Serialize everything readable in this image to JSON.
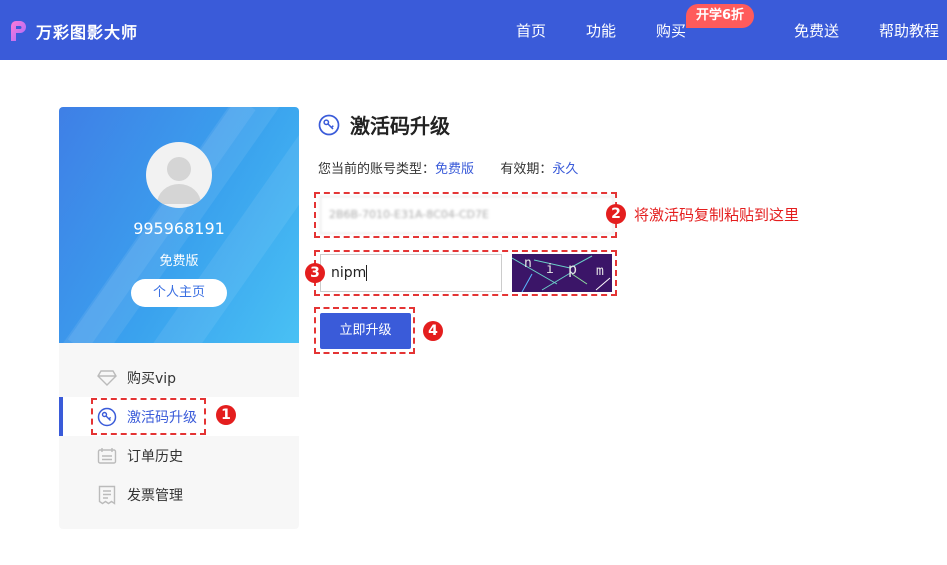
{
  "header": {
    "brand": "万彩图影大师",
    "nav": [
      {
        "label": "首页"
      },
      {
        "label": "功能"
      },
      {
        "label": "购买"
      },
      {
        "label": "免费送"
      },
      {
        "label": "帮助教程"
      }
    ],
    "promo_badge": "开学6折",
    "colors": {
      "bar": "#3a5bd9",
      "promo": "#ff5b5b"
    }
  },
  "sidebar": {
    "user_id": "995968191",
    "plan": "免费版",
    "home_button": "个人主页",
    "menu": [
      {
        "label": "购买vip",
        "icon": "diamond-icon"
      },
      {
        "label": "激活码升级",
        "icon": "activation-icon",
        "active": true
      },
      {
        "label": "订单历史",
        "icon": "order-history-icon"
      },
      {
        "label": "发票管理",
        "icon": "invoice-icon"
      }
    ]
  },
  "main": {
    "title": "激活码升级",
    "account_type_label": "您当前的账号类型：",
    "account_type_value": "免费版",
    "validity_label": "有效期：",
    "validity_value": "永久",
    "activation_code_value": "2B6B-7010-E31A-8C04-CD7E",
    "captcha_value": "nipm",
    "captcha_chars": [
      "n",
      "i",
      "p",
      "m"
    ],
    "submit_label": "立即升级"
  },
  "annotations": {
    "step1": "1",
    "step2": "2",
    "step2_hint": "将激活码复制粘贴到这里",
    "step3": "3",
    "step4": "4",
    "color": "#e41e1e"
  }
}
